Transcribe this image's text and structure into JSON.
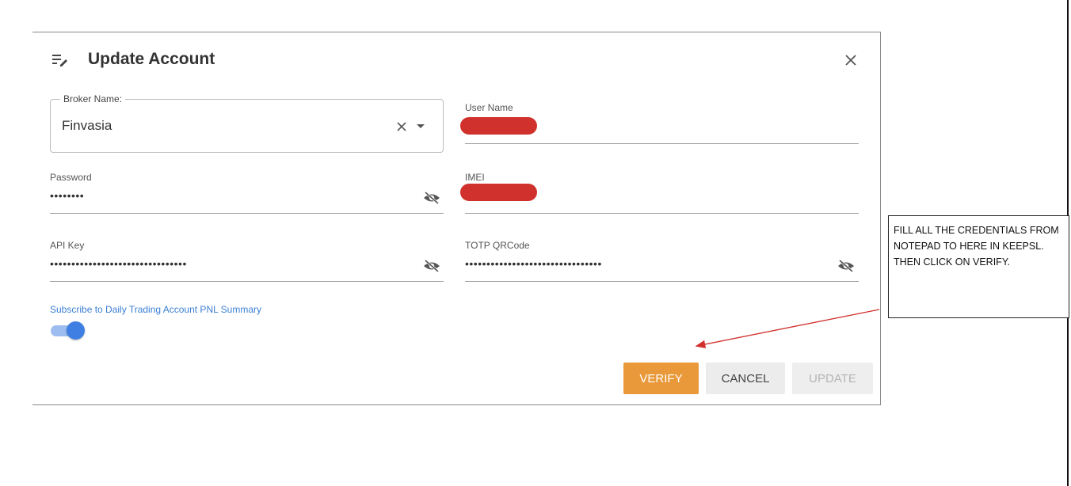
{
  "dialog": {
    "title": "Update Account",
    "title_icon": "edit-list-icon",
    "close_icon": "close-icon"
  },
  "form": {
    "broker": {
      "label": "Broker Name:",
      "value": "Finvasia"
    },
    "user_name": {
      "label": "User Name",
      "value": "[redacted]"
    },
    "password": {
      "label": "Password",
      "value": "••••••••"
    },
    "imei": {
      "label": "IMEI",
      "value": "[redacted]"
    },
    "api_key": {
      "label": "API Key",
      "value": "••••••••••••••••••••••••••••••••"
    },
    "totp": {
      "label": "TOTP QRCode",
      "value": "••••••••••••••••••••••••••••••••"
    },
    "subscribe": {
      "label": "Subscribe to Daily Trading Account PNL Summary",
      "enabled": true
    }
  },
  "buttons": {
    "verify": "VERIFY",
    "cancel": "CANCEL",
    "update": "UPDATE"
  },
  "annotation": {
    "text": "FILL ALL THE CREDENTIALS FROM NOTEPAD TO HERE IN KEEPSL. THEN CLICK ON VERIFY.",
    "arrow_color": "#d0312d"
  },
  "colors": {
    "accent_blue": "#3f7fe3",
    "verify_orange": "#e9993a",
    "redaction_red": "#d0312d"
  }
}
